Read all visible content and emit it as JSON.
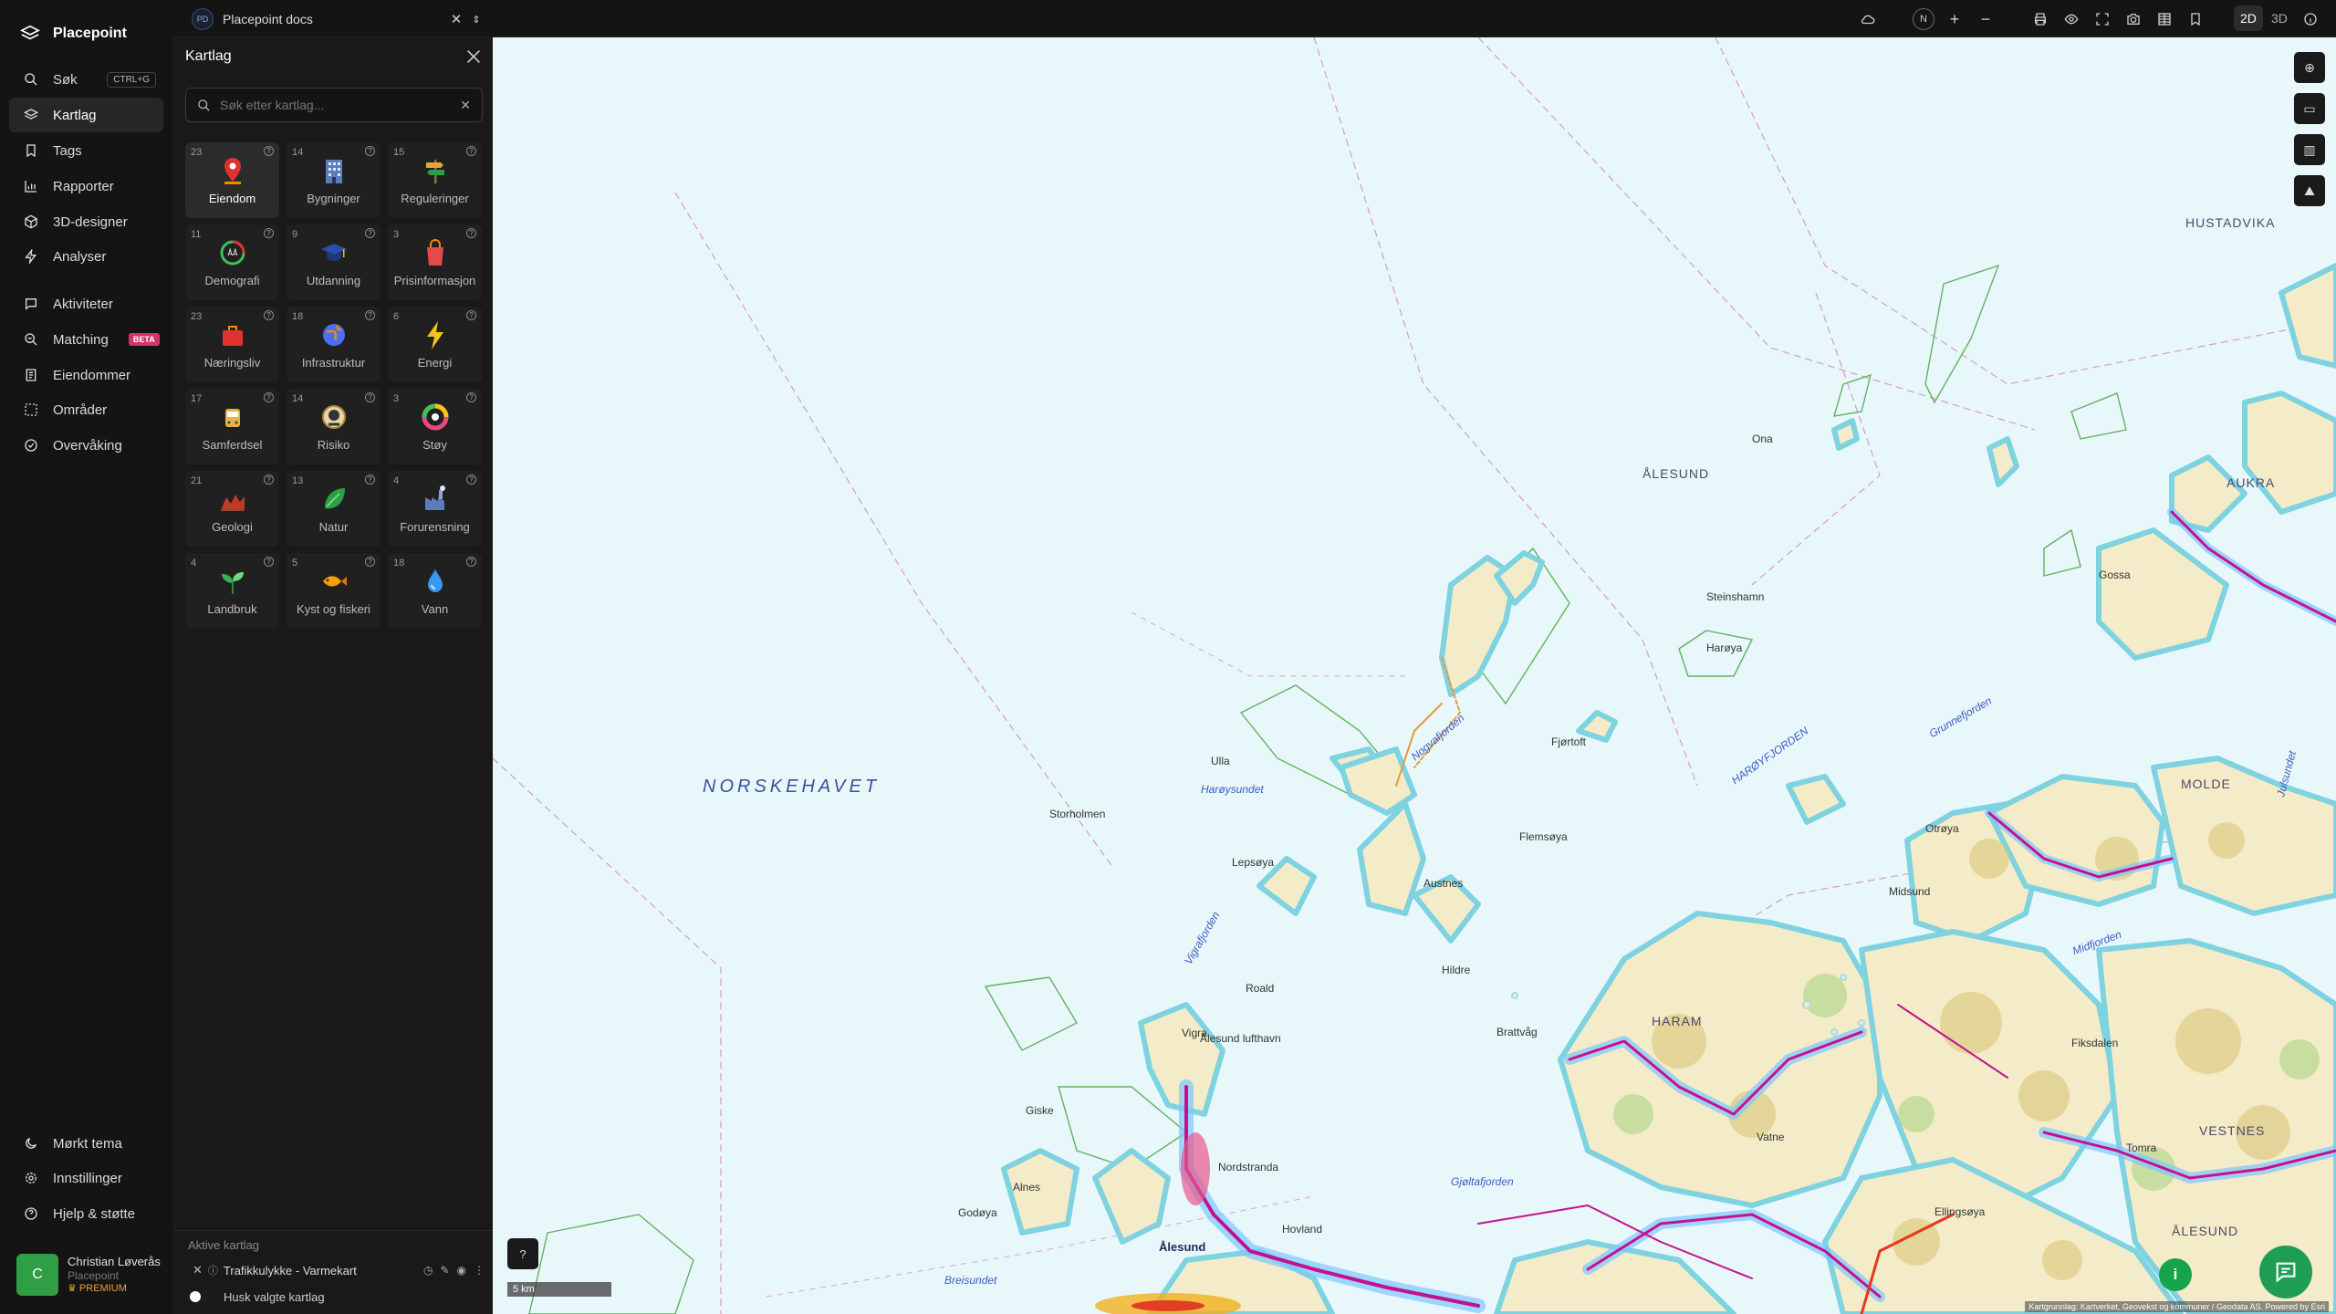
{
  "app": {
    "name": "Placepoint"
  },
  "nav": {
    "items": [
      {
        "label": "Søk",
        "shortcut": "CTRL+G",
        "icon": "search-icon"
      },
      {
        "label": "Kartlag",
        "icon": "layers-icon",
        "active": true
      },
      {
        "label": "Tags",
        "icon": "bookmark-icon"
      },
      {
        "label": "Rapporter",
        "icon": "bar-chart-icon"
      },
      {
        "label": "3D-designer",
        "icon": "cube-icon"
      },
      {
        "label": "Analyser",
        "icon": "lightning-icon"
      },
      {
        "label": "Aktiviteter",
        "icon": "chat-icon"
      },
      {
        "label": "Matching",
        "badge": "BETA",
        "icon": "match-search-icon"
      },
      {
        "label": "Eiendommer",
        "icon": "document-icon"
      },
      {
        "label": "Områder",
        "icon": "area-select-icon"
      },
      {
        "label": "Overvåking",
        "icon": "check-circle-icon"
      }
    ],
    "bottom": [
      {
        "label": "Mørkt tema",
        "icon": "moon-icon"
      },
      {
        "label": "Innstillinger",
        "icon": "gear-icon"
      },
      {
        "label": "Hjelp & støtte",
        "icon": "help-icon"
      }
    ]
  },
  "user": {
    "initial": "C",
    "name": "Christian Løverås",
    "org": "Placepoint",
    "plan": "PREMIUM"
  },
  "topbar": {
    "doc_badge": "PD",
    "doc_title": "Placepoint docs",
    "compass": "N",
    "mode_2d": "2D",
    "mode_3d": "3D"
  },
  "panel": {
    "title": "Kartlag",
    "search_placeholder": "Søk etter kartlag...",
    "categories": [
      {
        "label": "Eiendom",
        "count": "23",
        "icon": "map-pin-icon",
        "color": "#e03131",
        "active": true
      },
      {
        "label": "Bygninger",
        "count": "14",
        "icon": "building-icon",
        "color": "#5c7cba"
      },
      {
        "label": "Reguleringer",
        "count": "15",
        "icon": "signpost-icon",
        "color": "#e8a33a"
      },
      {
        "label": "Demografi",
        "count": "11",
        "icon": "demography-icon",
        "color": "#40c057"
      },
      {
        "label": "Utdanning",
        "count": "9",
        "icon": "graduation-cap-icon",
        "color": "#2b4fa8"
      },
      {
        "label": "Prisinformasjon",
        "count": "3",
        "icon": "shopping-bag-icon",
        "color": "#e64949"
      },
      {
        "label": "Næringsliv",
        "count": "23",
        "icon": "briefcase-icon",
        "color": "#e03131"
      },
      {
        "label": "Infrastruktur",
        "count": "18",
        "icon": "globe-icon",
        "color": "#4c6ef5"
      },
      {
        "label": "Energi",
        "count": "6",
        "icon": "lightning-bolt-icon",
        "color": "#f5c518"
      },
      {
        "label": "Samferdsel",
        "count": "17",
        "icon": "bus-icon",
        "color": "#e6b34a"
      },
      {
        "label": "Risiko",
        "count": "14",
        "icon": "hazard-icon",
        "color": "#b08a3a"
      },
      {
        "label": "Støy",
        "count": "3",
        "icon": "noise-gauge-icon",
        "color": "#e64980"
      },
      {
        "label": "Geologi",
        "count": "21",
        "icon": "terrain-icon",
        "color": "#c0392b"
      },
      {
        "label": "Natur",
        "count": "13",
        "icon": "leaf-icon",
        "color": "#2f9e44"
      },
      {
        "label": "Forurensning",
        "count": "4",
        "icon": "factory-icon",
        "color": "#5c7cba"
      },
      {
        "label": "Landbruk",
        "count": "4",
        "icon": "sprout-icon",
        "color": "#37b24d"
      },
      {
        "label": "Kyst og fiskeri",
        "count": "5",
        "icon": "fish-icon",
        "color": "#f59f00"
      },
      {
        "label": "Vann",
        "count": "18",
        "icon": "water-drop-icon",
        "color": "#339af0"
      }
    ],
    "active_title": "Aktive kartlag",
    "active_layer": "Trafikkulykke - Varmekart",
    "remember_label": "Husk valgte kartlag"
  },
  "map": {
    "labels": [
      {
        "text": "NORSKEHAVET",
        "kind": "sea"
      },
      {
        "text": "ÅLESUND",
        "kind": "area"
      },
      {
        "text": "AUKRA",
        "kind": "area"
      },
      {
        "text": "HUSTADVIKA",
        "kind": "area"
      },
      {
        "text": "HARAM",
        "kind": "area"
      },
      {
        "text": "MOLDE",
        "kind": "area"
      },
      {
        "text": "VESTNES",
        "kind": "area"
      },
      {
        "text": "ÅLESUND",
        "kind": "area"
      },
      {
        "text": "Ålesund",
        "kind": "town"
      },
      {
        "text": "Storholmen",
        "kind": "place"
      },
      {
        "text": "Vigra",
        "kind": "place"
      },
      {
        "text": "Roald",
        "kind": "place"
      },
      {
        "text": "Ålesund lufthavn",
        "kind": "place"
      },
      {
        "text": "Giske",
        "kind": "place"
      },
      {
        "text": "Godøya",
        "kind": "place"
      },
      {
        "text": "Alnes",
        "kind": "place"
      },
      {
        "text": "Lepsøya",
        "kind": "place"
      },
      {
        "text": "Harøya",
        "kind": "place"
      },
      {
        "text": "Fjørtoft",
        "kind": "place"
      },
      {
        "text": "Flemsøya",
        "kind": "place"
      },
      {
        "text": "Austnes",
        "kind": "place"
      },
      {
        "text": "Brattvåg",
        "kind": "place"
      },
      {
        "text": "Steinshamn",
        "kind": "place"
      },
      {
        "text": "Ona",
        "kind": "place"
      },
      {
        "text": "Midsund",
        "kind": "place"
      },
      {
        "text": "Otrøya",
        "kind": "place"
      },
      {
        "text": "Gossa",
        "kind": "place"
      },
      {
        "text": "Tomra",
        "kind": "place"
      },
      {
        "text": "Vatne",
        "kind": "place"
      },
      {
        "text": "Ellingsøya",
        "kind": "place"
      },
      {
        "text": "Nordstranda",
        "kind": "place"
      },
      {
        "text": "Hovland",
        "kind": "place"
      },
      {
        "text": "Fiksdalen",
        "kind": "place"
      },
      {
        "text": "Hildre",
        "kind": "place"
      },
      {
        "text": "Ulla",
        "kind": "place"
      },
      {
        "text": "Harøysundet",
        "kind": "fjord"
      },
      {
        "text": "Vigrafjorden",
        "kind": "fjord"
      },
      {
        "text": "Nogvafjorden",
        "kind": "fjord"
      },
      {
        "text": "HARØYFJORDEN",
        "kind": "fjord"
      },
      {
        "text": "Grunnefjorden",
        "kind": "fjord"
      },
      {
        "text": "Midfjorden",
        "kind": "fjord"
      },
      {
        "text": "Breisundet",
        "kind": "fjord"
      },
      {
        "text": "Gjøltafjorden",
        "kind": "fjord"
      },
      {
        "text": "Julsundet",
        "kind": "fjord"
      }
    ],
    "scale_label": "5 km",
    "attribution": "Kartgrunnlag: Kartverket, Geovekst og kommuner / Geodata AS. Powered by Esri"
  }
}
